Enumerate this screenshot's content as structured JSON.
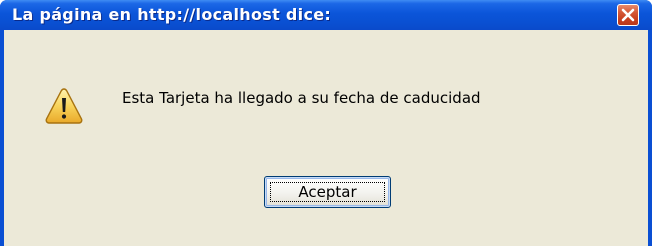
{
  "dialog": {
    "title": "La página en http://localhost dice:",
    "message": "Esta Tarjeta ha llegado a su fecha de caducidad",
    "icon": "warning-icon",
    "ok_label": "Aceptar",
    "close_icon": "close-icon"
  },
  "colors": {
    "titlebar": "#0a50d2",
    "close_button": "#c8401f",
    "client_background": "#ece9d8",
    "warning_fill": "#f6c94b"
  }
}
